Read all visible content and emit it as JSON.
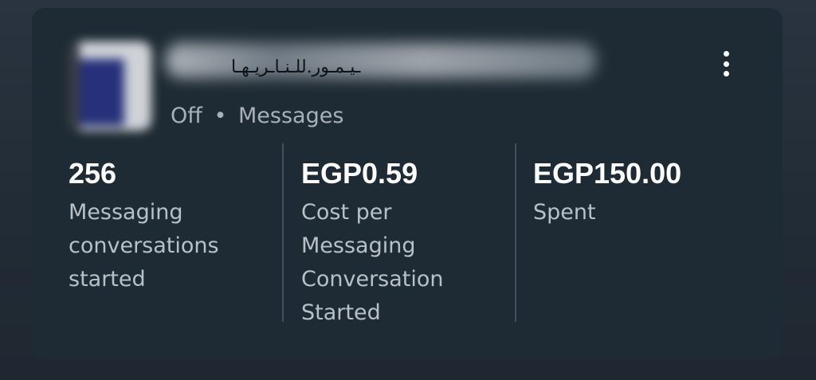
{
  "campaign": {
    "status": "Off",
    "separator": "•",
    "objective": "Messages"
  },
  "metrics": [
    {
      "value": "256",
      "label_lines": [
        "Messaging",
        "conversations",
        "started"
      ]
    },
    {
      "value": "EGP0.59",
      "label_lines": [
        "Cost per",
        "Messaging",
        "Conversation",
        "Started"
      ]
    },
    {
      "value": "EGP150.00",
      "label_lines": [
        "Spent"
      ]
    }
  ],
  "icons": {
    "menu": "more-vertical-icon"
  },
  "colors": {
    "card_background": "#1f2b34",
    "value_text": "#ffffff",
    "label_text": "#b8c0c8"
  }
}
